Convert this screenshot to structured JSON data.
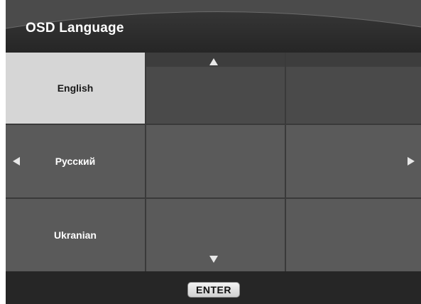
{
  "title": "OSD Language",
  "languages": [
    {
      "label": "English",
      "selected": true
    },
    {
      "label": "Русский",
      "selected": false
    },
    {
      "label": "Ukranian",
      "selected": false
    }
  ],
  "enter_label": "ENTER",
  "colors": {
    "background": "#2a2a2a",
    "cell": "#5a5a5a",
    "cell_dark": "#4a4a4a",
    "selected": "#d6d6d6",
    "text": "#ffffff"
  },
  "icons": {
    "scroll_up": "triangle-up-icon",
    "scroll_down": "triangle-down-icon",
    "page_left": "triangle-left-icon",
    "page_right": "triangle-right-icon"
  }
}
